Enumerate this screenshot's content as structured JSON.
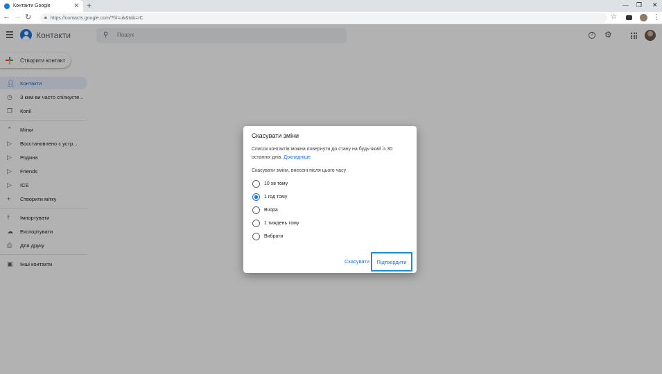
{
  "browser": {
    "tab_title": "Контакти Google",
    "tab_close": "✕",
    "new_tab": "+",
    "url": "https://contacts.google.com/?hl=uk&tab=rC",
    "controls": {
      "minimize": "—",
      "maximize": "❐",
      "close": "✕"
    },
    "nav": {
      "back": "←",
      "forward": "→",
      "reload": "↻"
    }
  },
  "header": {
    "title": "Контакти",
    "search_placeholder": "Пошук",
    "help_glyph": "?"
  },
  "sidebar": {
    "create_label": "Створити контакт",
    "items": [
      {
        "label": "Контакти",
        "icon": "person-icon"
      },
      {
        "label": "З ким ви часто спілкуєте...",
        "icon": "history-icon"
      },
      {
        "label": "Копії",
        "icon": "copy-icon"
      },
      {
        "label": "Мітки",
        "icon": "chevron-up-icon"
      },
      {
        "label": "Восстановлено с устр...",
        "icon": "label-icon"
      },
      {
        "label": "Родина",
        "icon": "label-icon"
      },
      {
        "label": "Friends",
        "icon": "label-icon"
      },
      {
        "label": "ICE",
        "icon": "label-icon"
      },
      {
        "label": "Створити мітку",
        "icon": "plus-icon"
      },
      {
        "label": "Імпортувати",
        "icon": "upload-icon"
      },
      {
        "label": "Експортувати",
        "icon": "cloud-icon"
      },
      {
        "label": "Для друку",
        "icon": "print-icon"
      },
      {
        "label": "Інші контакти",
        "icon": "contacts-box-icon"
      }
    ]
  },
  "dialog": {
    "title": "Скасувати зміни",
    "description": "Список контактів можна повернути до стану на будь-який із 30 останніх днів.",
    "learn_more": "Докладніше",
    "subtitle": "Скасувати зміни, внесені після цього часу",
    "options": [
      {
        "label": "10 хв тому",
        "checked": false
      },
      {
        "label": "1 год тому",
        "checked": true
      },
      {
        "label": "Вчора",
        "checked": false
      },
      {
        "label": "1 тиждень тому",
        "checked": false
      },
      {
        "label": "Вибрати",
        "checked": false
      }
    ],
    "cancel_label": "Скасувати",
    "confirm_label": "Підтвердити"
  },
  "colors": {
    "accent": "#1a73e8",
    "highlight_box": "#1a8fd0",
    "active_nav_bg": "#e8f0fe"
  }
}
